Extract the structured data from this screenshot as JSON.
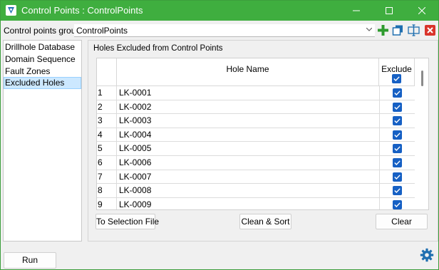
{
  "window": {
    "title": "Control Points : ControlPoints",
    "colors": {
      "titlebar": "#3fae3f",
      "accent": "#1660c4",
      "selection": "#cce8ff"
    }
  },
  "toolbar": {
    "group_label": "Control points group",
    "group_value": "ControlPoints",
    "icons": [
      "add-icon",
      "copy-icon",
      "rename-icon",
      "delete-icon"
    ]
  },
  "sidebar": {
    "items": [
      {
        "label": "Drillhole Database"
      },
      {
        "label": "Domain Sequence"
      },
      {
        "label": "Fault Zones"
      },
      {
        "label": "Excluded Holes",
        "selected": true
      }
    ]
  },
  "panel": {
    "title": "Holes Excluded from Control Points",
    "table": {
      "columns": [
        "Hole Name",
        "Exclude"
      ],
      "header_exclude_checked": true,
      "rows": [
        {
          "num": "1",
          "name": "LK-0001",
          "exclude": true
        },
        {
          "num": "2",
          "name": "LK-0002",
          "exclude": true
        },
        {
          "num": "3",
          "name": "LK-0003",
          "exclude": true
        },
        {
          "num": "4",
          "name": "LK-0004",
          "exclude": true
        },
        {
          "num": "5",
          "name": "LK-0005",
          "exclude": true
        },
        {
          "num": "6",
          "name": "LK-0006",
          "exclude": true
        },
        {
          "num": "7",
          "name": "LK-0007",
          "exclude": true
        },
        {
          "num": "8",
          "name": "LK-0008",
          "exclude": true
        },
        {
          "num": "9",
          "name": "LK-0009",
          "exclude": true
        }
      ]
    },
    "buttons": {
      "to_selection_file": "To Selection File",
      "clean_sort": "Clean & Sort",
      "clear": "Clear"
    }
  },
  "footer": {
    "run": "Run"
  }
}
